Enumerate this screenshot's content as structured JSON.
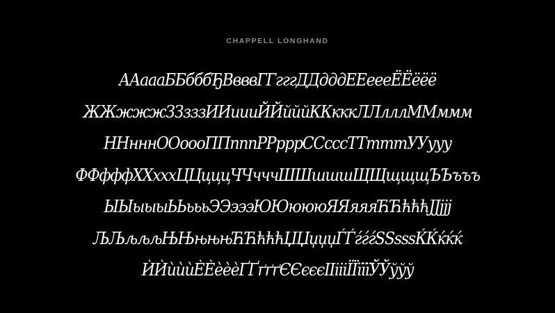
{
  "title": "CHAPPELL LONGHAND",
  "rows": [
    "AАаааББбббЂВвввГГгггДДдддЕЕееeЁЁёёё",
    "ЖЖжжжЗЗзззИИиииЙЙйййККкккЛЛлллММммм",
    "ННнннООоооППпппРРрррСCсссТТтттУУууу",
    "ФФфффХХхххЦЦцццЧЧчччШШшшшЩЩщщщЪЪъъъ",
    "ЫЫыыыЬЬьььЭЭэээЮЮюююЯЯяяяЋЋћћћЈЈјјј",
    "ЉЉљљљЊЊњњњЋЋћћћЏЏџџџЃЃѓѓѓЅЅѕѕѕЌЌќќќ",
    "ЍЍѝѝѝЀЀѐѐѐҐҐґґґЄЄєєєІІіііЇЇїїїЎЎўўў"
  ],
  "colors": {
    "background": "#000000",
    "title": "#8e8e8e",
    "glyphs": "#ffffff"
  }
}
